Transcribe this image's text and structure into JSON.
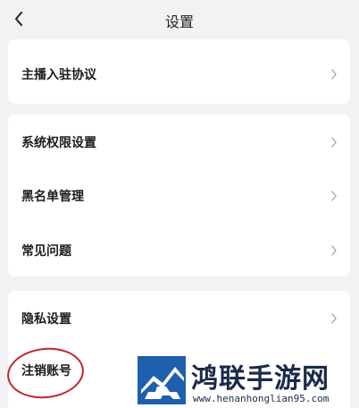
{
  "nav": {
    "title": "设置"
  },
  "cards": [
    {
      "items": [
        "主播入驻协议"
      ]
    },
    {
      "items": [
        "系统权限设置",
        "黑名单管理",
        "常见问题"
      ]
    },
    {
      "items": [
        "隐私设置",
        "注销账号"
      ]
    }
  ],
  "watermark": {
    "title": "鸿联手游网",
    "url": "www.henanhonglian95.com"
  },
  "colors": {
    "highlight_oval": "#c0262d",
    "watermark_blue": "#1f5fae",
    "background": "#f2f2f4"
  }
}
